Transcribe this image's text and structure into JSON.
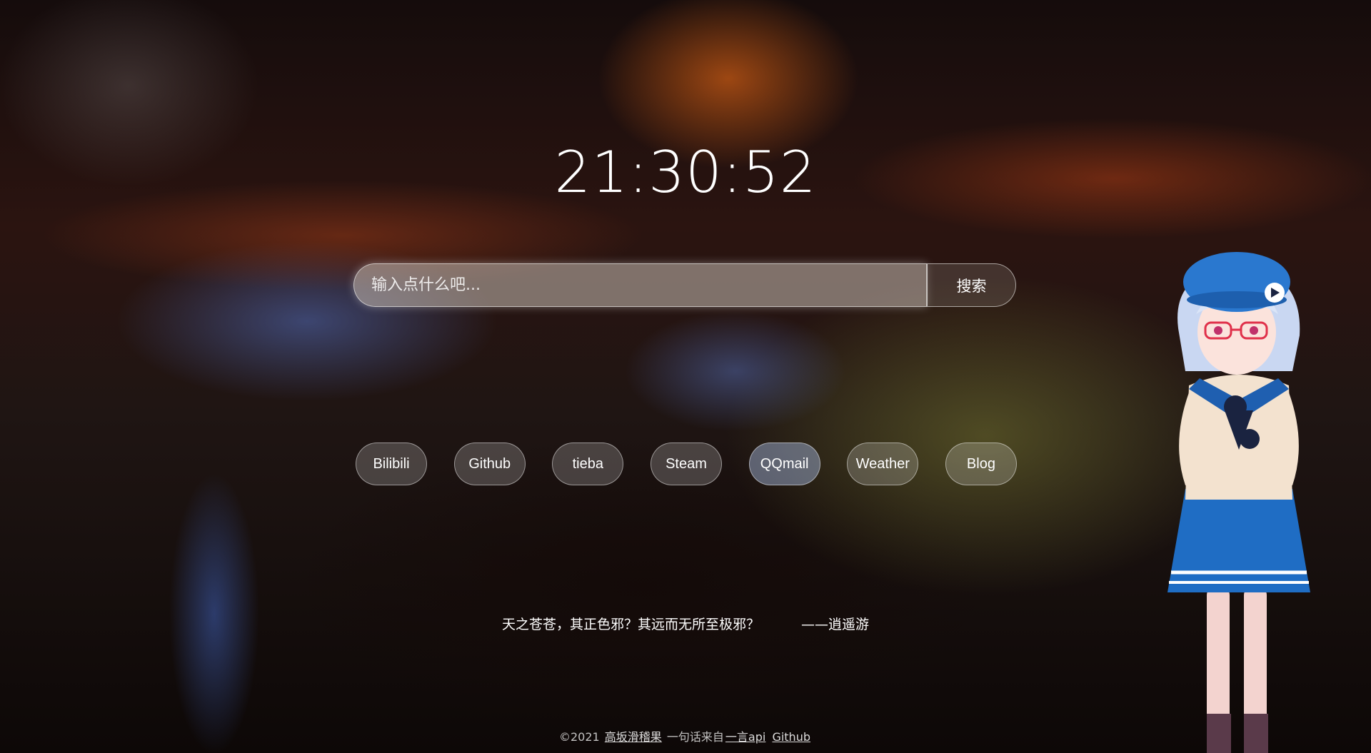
{
  "clock": {
    "time": "21:30:52"
  },
  "search": {
    "placeholder": "输入点什么吧...",
    "button_label": "搜索"
  },
  "links": [
    {
      "label": "Bilibili"
    },
    {
      "label": "Github"
    },
    {
      "label": "tieba"
    },
    {
      "label": "Steam"
    },
    {
      "label": "QQmail"
    },
    {
      "label": "Weather"
    },
    {
      "label": "Blog"
    }
  ],
  "quote": {
    "text": "天之苍苍，其正色邪？其远而无所至极邪？",
    "from": "——逍遥游"
  },
  "footer": {
    "copyright": "©2021",
    "author_link": "高坂滑稽果",
    "source_prefix": "一句话来自",
    "api_link": "一言api",
    "github_link": "Github"
  },
  "mascot": {
    "icon": "anime-girl-mascot"
  }
}
